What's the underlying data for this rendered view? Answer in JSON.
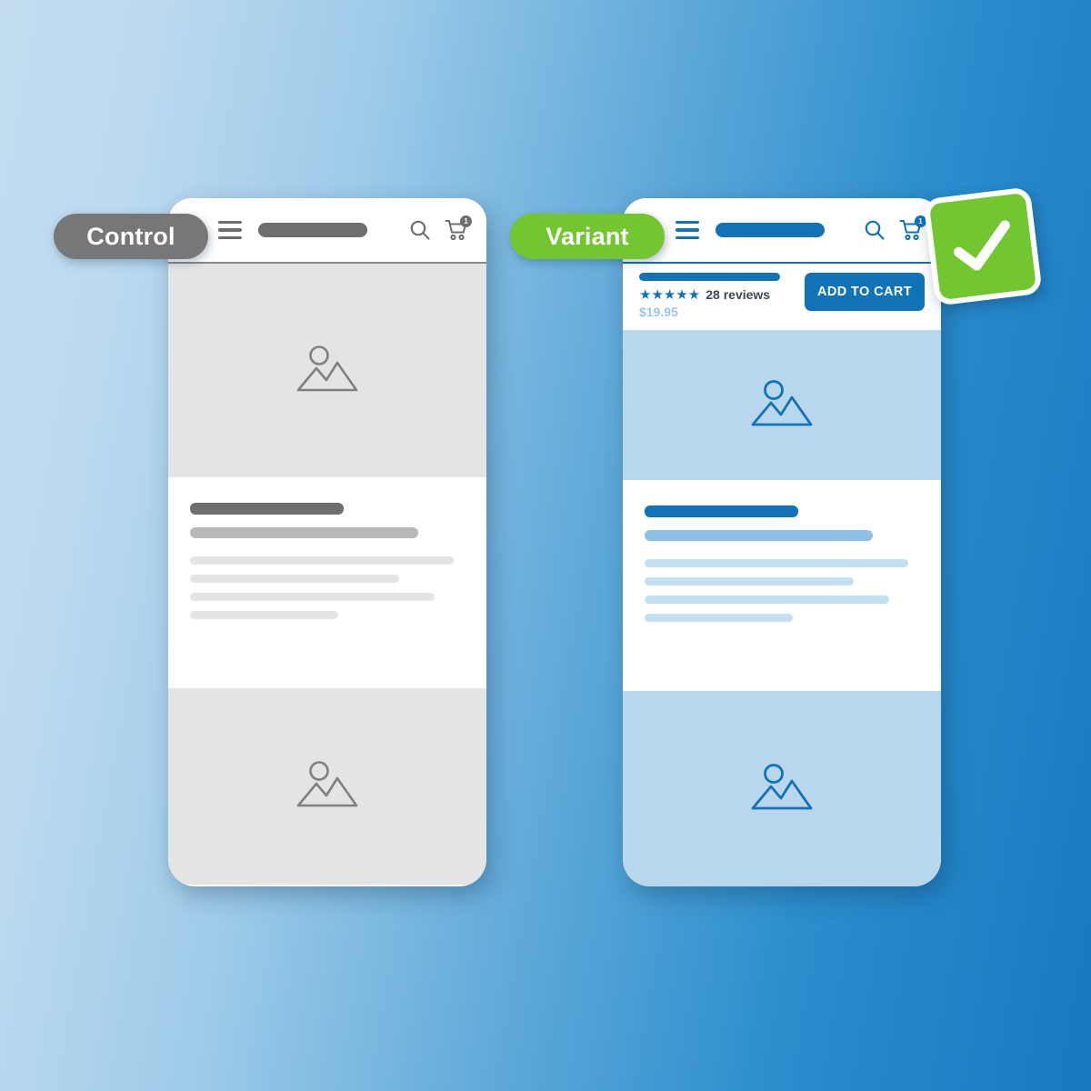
{
  "background": {
    "gradient_from": "#bcd9ef",
    "gradient_to": "#1878c0"
  },
  "labels": {
    "control": "Control",
    "variant": "Variant",
    "control_color": "#777777",
    "variant_color": "#72c62f"
  },
  "control_phone": {
    "nav": {
      "menu_icon": "hamburger-icon",
      "logo_placeholder": "",
      "search_icon": "search-icon",
      "cart_icon": "cart-icon",
      "cart_count": "1"
    },
    "hero": {
      "image_icon": "image-placeholder-icon"
    },
    "copy": {
      "title": "",
      "subtitle": "",
      "lines": [
        "",
        "",
        "",
        ""
      ]
    },
    "footer": {
      "image_icon": "image-placeholder-icon"
    },
    "accent": "#6e6e6e",
    "band_color": "#e4e4e4"
  },
  "variant_phone": {
    "nav": {
      "menu_icon": "hamburger-icon",
      "logo_placeholder": "",
      "search_icon": "search-icon",
      "cart_icon": "cart-icon",
      "cart_count": "1"
    },
    "cta": {
      "title_placeholder": "",
      "stars": "★★★★★",
      "rating_count": 5,
      "reviews_label": "28 reviews",
      "price": "$19.95",
      "button_label": "ADD TO CART",
      "button_color": "#1272b6"
    },
    "hero": {
      "image_icon": "image-placeholder-icon"
    },
    "copy": {
      "title": "",
      "subtitle": "",
      "lines": [
        "",
        "",
        "",
        ""
      ]
    },
    "footer": {
      "image_icon": "image-placeholder-icon"
    },
    "accent": "#1272b6",
    "band_color": "#b8d6ec"
  },
  "badge": {
    "icon": "check-mark-icon",
    "color": "#72c62f"
  }
}
